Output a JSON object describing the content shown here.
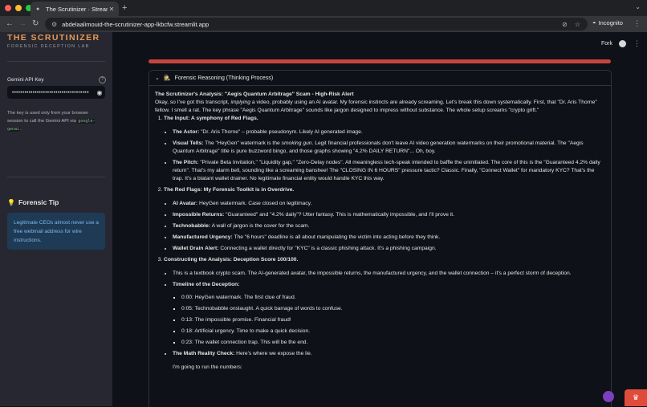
{
  "browser": {
    "tab_title": "The Scrutinizer · Streamlit",
    "url": "abdelaalimouid-the-scrutinizer-app-lkbcfw.streamlit.app",
    "mode_label": "Incognito"
  },
  "sidebar": {
    "brand": "THE SCRUTINIZER",
    "subtitle": "FORENSIC DECEPTION LAB",
    "api_label": "Gemini API Key",
    "api_value": "••••••••••••••••••••••••••••••••••••••",
    "api_note_text": "The key is used only from your browser session to call the Gemini API via",
    "api_note_code": "google-genai",
    "api_note_tail": ".",
    "tip_heading": "Forensic Tip",
    "tip_text": "Legitimate CEOs almost never use a free webmail address for wire instructions."
  },
  "header": {
    "fork_label": "Fork"
  },
  "expander": {
    "title": "Forensic Reasoning (Thinking Process)"
  },
  "analysis": {
    "title": "The Scrutinizer's Analysis: \"Aegis Quantum Arbitrage\" Scam - High-Risk Alert",
    "intro_a": "Okay, so I've got this transcript,",
    "intro_em": "implying",
    "intro_b": "a video, probably using an AI avatar. My forensic instincts are already screaming. Let's break this down systematically. First, that \"Dr. Aris Thorne\" fellow. I smell a rat. The key phrase \"Aegis Quantum Arbitrage\" sounds like jargon designed to impress without substance. The whole setup screams \"crypto grift.\"",
    "s1_title": "The Input: A symphony of Red Flags.",
    "s1_actor_label": "The Actor:",
    "s1_actor_text": "\"Dr. Aris Thorne\" – probable pseudonym. Likely AI generated image.",
    "s1_visual_label": "Visual Tells:",
    "s1_visual_a": "The \"HeyGen\" watermark is the",
    "s1_visual_em": "smoking gun",
    "s1_visual_b": ". Legit financial professionals don't leave AI video generation watermarks on their promotional material. The \"Aegis Quantum Arbitrage\" title is pure buzzword bingo, and those graphs showing \"4.2% DAILY RETURN\"... Oh, boy.",
    "s1_pitch_label": "The Pitch:",
    "s1_pitch_text": "\"Private Beta Invitation,\" \"Liquidity gap,\" \"Zero-Delay nodes\". All meaningless tech-speak intended to baffle the uninitiated. The core of this is the \"Guaranteed 4.2% daily return\". That's my alarm bell, sounding like a screaming banshee! The \"CLOSING IN 6 HOURS\" pressure tactic? Classic. Finally, \"Connect Wallet\" for mandatory KYC? That's the trap. It's a blatant wallet drainer. No legitimate financial entity would handle KYC this way.",
    "s2_title": "The Red Flags: My Forensic Toolkit is in Overdrive.",
    "s2_items": [
      {
        "label": "AI Avatar:",
        "text": "HeyGen watermark. Case closed on legitimacy."
      },
      {
        "label": "Impossible Returns:",
        "text": "\"Guaranteed\" and \"4.2% daily\"? Utter fantasy. This is mathematically impossible, and I'll prove it."
      },
      {
        "label": "Technobabble:",
        "text": "A wall of jargon is the cover for the scam."
      },
      {
        "label": "Manufactured Urgency:",
        "text": "The \"6 hours\" deadline is all about manipulating the victim into acting before they think."
      },
      {
        "label": "Wallet Drain Alert:",
        "text": "Connecting a wallet directly for \"KYC\" is a classic phishing attack. It's a phishing campaign."
      }
    ],
    "s3_title": "Constructing the Analysis: Deception Score 100/100.",
    "s3_summary": "This is a textbook crypto scam. The AI-generated avatar, the impossible returns, the manufactured urgency, and the wallet connection – it's a perfect storm of deception.",
    "timeline_label": "Timeline of the Deception:",
    "timeline": [
      "0:00: HeyGen watermark. The first clue of fraud.",
      "0:05: Technobabble onslaught. A quick barrage of words to confuse.",
      "0:13: The impossible promise. Financial fraud!",
      "0:18: Artificial urgency. Time to make a quick decision.",
      "0:23: The wallet connection trap. This will be the end."
    ],
    "math_label": "The Math Reality Check:",
    "math_text": "Here's where we expose the lie.",
    "numbers_text": "I'm going to run the numbers:"
  },
  "colors": {
    "brand": "#e89a52",
    "progress": "#c6443f",
    "tip_bg": "#1f3a55",
    "tip_text": "#7cb9ee"
  },
  "icons": [
    "back-icon",
    "forward-icon",
    "reload-icon",
    "site-info-icon",
    "eye-off-icon",
    "star-icon",
    "incognito-icon",
    "help-icon",
    "eye-icon",
    "bulb-icon",
    "github-icon",
    "chevron-down-icon",
    "detective-icon",
    "crown-icon"
  ]
}
